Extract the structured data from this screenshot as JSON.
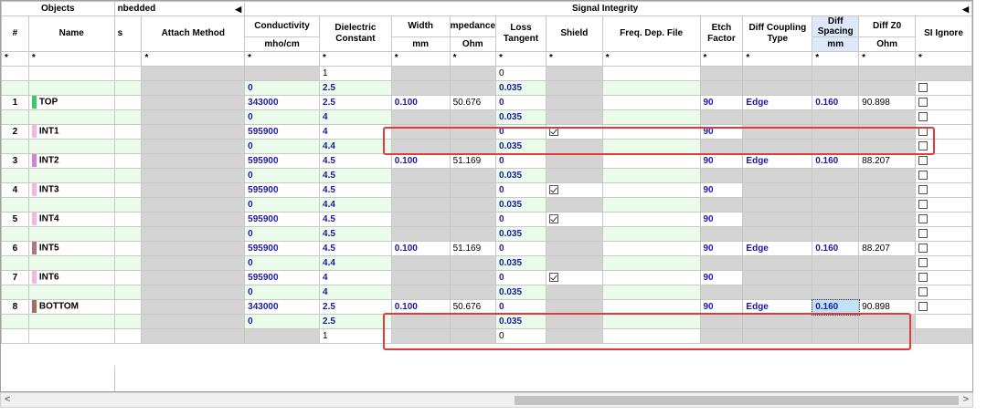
{
  "groups": {
    "objects": "Objects",
    "embedded": "nbedded",
    "signal_integrity": "Signal Integrity"
  },
  "headers": {
    "num": "#",
    "name": "Name",
    "s": "s",
    "attach": "Attach Method",
    "conductivity": "Conductivity",
    "conductivity_unit": "mho/cm",
    "dielectric": "Dielectric Constant",
    "width": "Width",
    "width_unit": "mm",
    "impedance": "mpedance",
    "impedance_unit": "Ohm",
    "loss": "Loss Tangent",
    "shield": "Shield",
    "freq": "Freq. Dep. File",
    "etch": "Etch Factor",
    "diffcoup": "Diff Coupling Type",
    "diffspacing": "Diff Spacing",
    "diffspacing_unit": "mm",
    "diffz0": "Diff Z0",
    "diffz0_unit": "Ohm",
    "siignore": "SI Ignore"
  },
  "filter_star": "*",
  "rows": [
    {
      "kind": "plain",
      "dielectric": "1",
      "loss": "0"
    },
    {
      "kind": "diel",
      "conductivity": "0",
      "dielectric": "2.5",
      "loss": "0.035",
      "si": false
    },
    {
      "kind": "layer",
      "num": "1",
      "name": "TOP",
      "color": "#33cc66",
      "conductivity": "343000",
      "dielectric": "2.5",
      "width": "0.100",
      "impedance": "50.676",
      "loss": "0",
      "shield": null,
      "etch": "90",
      "diffcoup": "Edge",
      "diffspacing": "0.160",
      "diffz0": "90.898",
      "si": false
    },
    {
      "kind": "diel",
      "conductivity": "0",
      "dielectric": "4",
      "loss": "0.035",
      "si": false
    },
    {
      "kind": "layer",
      "num": "2",
      "name": "INT1",
      "color": "#f2b6e0",
      "conductivity": "595900",
      "dielectric": "4",
      "width": "",
      "impedance": "",
      "loss": "0",
      "shield": true,
      "etch": "90",
      "diffcoup": "",
      "diffspacing": "",
      "diffz0": "",
      "si": false
    },
    {
      "kind": "diel",
      "conductivity": "0",
      "dielectric": "4.4",
      "loss": "0.035",
      "si": false
    },
    {
      "kind": "layer",
      "num": "3",
      "name": "INT2",
      "color": "#d97de0",
      "conductivity": "595900",
      "dielectric": "4.5",
      "width": "0.100",
      "impedance": "51.169",
      "loss": "0",
      "shield": null,
      "etch": "90",
      "diffcoup": "Edge",
      "diffspacing": "0.160",
      "diffz0": "88.207",
      "si": false
    },
    {
      "kind": "diel",
      "conductivity": "0",
      "dielectric": "4.5",
      "loss": "0.035",
      "si": false
    },
    {
      "kind": "layer",
      "num": "4",
      "name": "INT3",
      "color": "#f2b6e0",
      "conductivity": "595900",
      "dielectric": "4.5",
      "width": "",
      "impedance": "",
      "loss": "0",
      "shield": true,
      "etch": "90",
      "diffcoup": "",
      "diffspacing": "",
      "diffz0": "",
      "si": false
    },
    {
      "kind": "diel",
      "conductivity": "0",
      "dielectric": "4.4",
      "loss": "0.035",
      "si": false
    },
    {
      "kind": "layer",
      "num": "5",
      "name": "INT4",
      "color": "#f2b6e0",
      "conductivity": "595900",
      "dielectric": "4.5",
      "width": "",
      "impedance": "",
      "loss": "0",
      "shield": true,
      "etch": "90",
      "diffcoup": "",
      "diffspacing": "",
      "diffz0": "",
      "si": false
    },
    {
      "kind": "diel",
      "conductivity": "0",
      "dielectric": "4.5",
      "loss": "0.035",
      "si": false
    },
    {
      "kind": "layer",
      "num": "6",
      "name": "INT5",
      "color": "#a87a7a",
      "conductivity": "595900",
      "dielectric": "4.5",
      "width": "0.100",
      "impedance": "51.169",
      "loss": "0",
      "shield": null,
      "etch": "90",
      "diffcoup": "Edge",
      "diffspacing": "0.160",
      "diffz0": "88.207",
      "si": false
    },
    {
      "kind": "diel",
      "conductivity": "0",
      "dielectric": "4.4",
      "loss": "0.035",
      "si": false
    },
    {
      "kind": "layer",
      "num": "7",
      "name": "INT6",
      "color": "#f2b6e0",
      "conductivity": "595900",
      "dielectric": "4",
      "width": "",
      "impedance": "",
      "loss": "0",
      "shield": true,
      "etch": "90",
      "diffcoup": "",
      "diffspacing": "",
      "diffz0": "",
      "si": false
    },
    {
      "kind": "diel",
      "conductivity": "0",
      "dielectric": "4",
      "loss": "0.035",
      "si": false
    },
    {
      "kind": "layer",
      "num": "8",
      "name": "BOTTOM",
      "color": "#a86a5a",
      "conductivity": "343000",
      "dielectric": "2.5",
      "width": "0.100",
      "impedance": "50.676",
      "loss": "0",
      "shield": null,
      "etch": "90",
      "diffcoup": "Edge",
      "diffspacing": "0.160",
      "diffz0": "90.898",
      "si": false,
      "highlight_spacing": true
    },
    {
      "kind": "diel",
      "conductivity": "0",
      "dielectric": "2.5",
      "loss": "0.035",
      "si": null
    },
    {
      "kind": "plain",
      "dielectric": "1",
      "loss": "0"
    }
  ],
  "scrollbar": {
    "left": "<",
    "right": ">"
  }
}
